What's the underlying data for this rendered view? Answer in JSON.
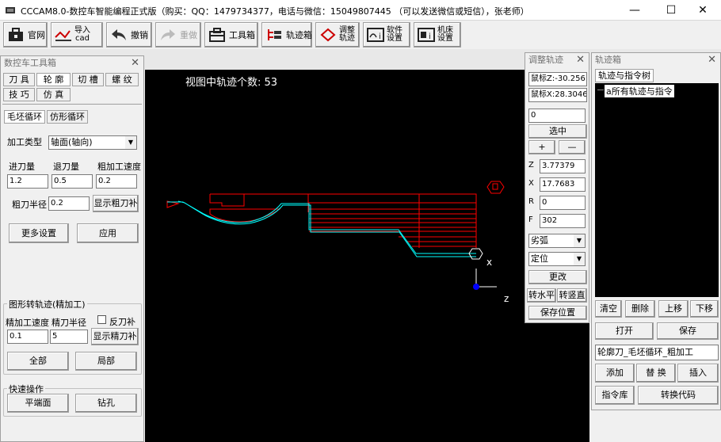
{
  "window": {
    "title": "CCCAM8.0-数控车智能编程正式版（购买：QQ：1479734377，电话与微信：15049807445 （可以发送微信或短信），张老师）",
    "minimize": "—",
    "maximize": "☐",
    "close": "✕"
  },
  "toolbar": {
    "website": "官网",
    "import_cad_1": "导入",
    "import_cad_2": "cad",
    "undo": "撤销",
    "redo": "重做",
    "toolbox": "工具箱",
    "trackbox": "轨迹箱",
    "adjust_1": "调整",
    "adjust_2": "轨迹",
    "software_1": "软件",
    "software_2": "设置",
    "machine_1": "机床",
    "machine_2": "设置"
  },
  "toolbox_panel": {
    "title": "数控车工具箱",
    "tabs_row1": [
      "刀 具",
      "轮 廓",
      "切 槽",
      "螺 纹"
    ],
    "tabs_row2": [
      "技 巧",
      "仿 真"
    ],
    "subtabs": [
      "毛坯循环",
      "仿形循环"
    ],
    "machining_type_label": "加工类型",
    "machining_type_value": "轴面(轴向)",
    "feed_label": "进刀量",
    "retract_label": "退刀量",
    "rough_speed_label": "粗加工速度",
    "feed_value": "1.2",
    "retract_value": "0.5",
    "rough_speed_value": "0.2",
    "rough_radius_label": "粗刀半径",
    "rough_radius_value": "0.2",
    "show_rough_comp": "显示粗刀补",
    "more_settings": "更多设置",
    "apply": "应用",
    "finish_group": "图形转轨迹(精加工)",
    "finish_speed_label": "精加工速度",
    "finish_radius_label": "精刀半径",
    "reverse_comp_label": "反刀补",
    "finish_speed_value": "0.1",
    "finish_radius_value": "5",
    "show_finish_comp": "显示精刀补",
    "all": "全部",
    "partial": "局部",
    "quick_group": "快速操作",
    "face": "平端面",
    "drill": "钻孔"
  },
  "viewport": {
    "track_count_label": "视图中轨迹个数: 53",
    "axis_x": "x",
    "axis_z": "z"
  },
  "adjust_panel": {
    "title": "调整轨迹",
    "mouse_z": "鼠标Z:-30.256",
    "mouse_x": "鼠标X:28.3046",
    "index_value": "0",
    "select": "选中",
    "plus": "+",
    "minus": "—",
    "z_label": "Z",
    "z_value": "3.77379",
    "x_label": "X",
    "x_value": "17.7683",
    "r_label": "R",
    "r_value": "0",
    "f_label": "F",
    "f_value": "302",
    "arc_type": "劣弧",
    "position": "定位",
    "change": "更改",
    "to_horizontal": "转水平",
    "to_vertical": "转竖直",
    "save_position": "保存位置"
  },
  "track_panel": {
    "title": "轨迹箱",
    "tab": "轨迹与指令树",
    "tree_root": "a所有轨迹与指令",
    "clear": "清空",
    "delete": "删除",
    "move_up": "上移",
    "move_down": "下移",
    "open": "打开",
    "save": "保存",
    "command_text": "轮廓刀_毛坯循环_粗加工",
    "add": "添加",
    "replace": "替 换",
    "insert": "插入",
    "command_lib": "指令库",
    "convert_code": "转换代码"
  },
  "colors": {
    "background": "#000000",
    "rough_path": "#ff0000",
    "finish_path": "#00ffff",
    "origin": "#0000ff"
  }
}
